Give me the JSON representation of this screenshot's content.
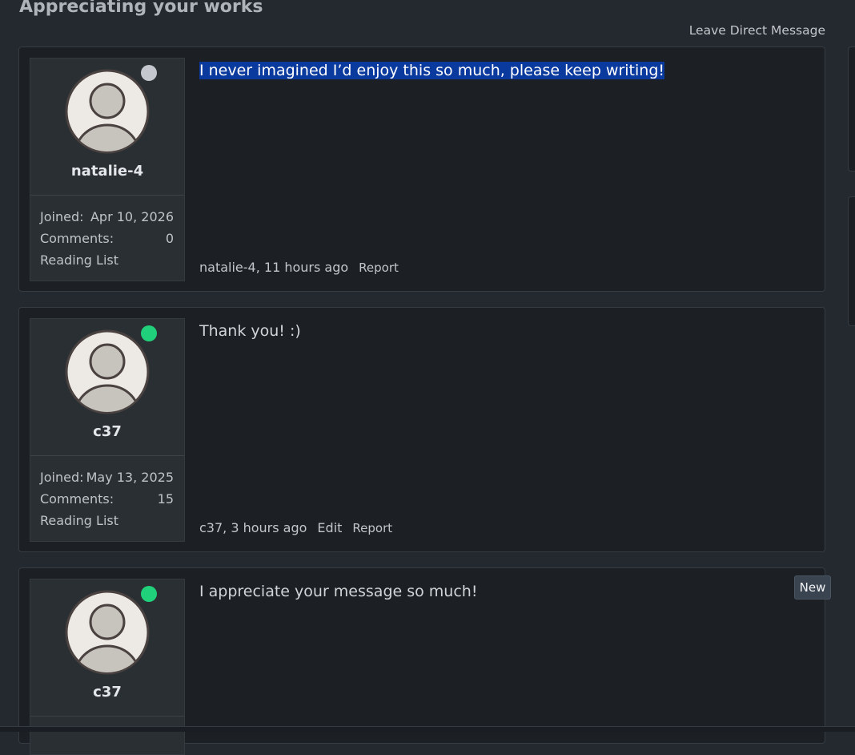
{
  "page": {
    "title": "Appreciating your works",
    "direct_message_link": "Leave Direct Message"
  },
  "posts": [
    {
      "user": {
        "name": "natalie-4",
        "status": "offline",
        "status_color": "#c4c8ce",
        "joined_label": "Joined:",
        "joined": "Apr 10, 2026",
        "comments_label": "Comments:",
        "comments": "0",
        "reading_list": "Reading List"
      },
      "message": "I never imagined I’d enjoy this so much, please keep writing!",
      "message_selected": true,
      "meta": {
        "author_time": "natalie-4, 11 hours ago",
        "report": "Report"
      }
    },
    {
      "user": {
        "name": "c37",
        "status": "online",
        "status_color": "#21d07a",
        "joined_label": "Joined:",
        "joined": "May 13, 2025",
        "comments_label": "Comments:",
        "comments": "15",
        "reading_list": "Reading List"
      },
      "message": "Thank you! :)",
      "message_selected": false,
      "meta": {
        "author_time": "c37, 3 hours ago",
        "edit": "Edit",
        "report": "Report"
      }
    },
    {
      "user": {
        "name": "c37",
        "status": "online",
        "status_color": "#21d07a"
      },
      "message": "I appreciate your message so much!",
      "message_selected": false,
      "badge": "New"
    }
  ],
  "icons": {
    "avatar": "user-avatar-icon",
    "status": "status-dot-icon"
  },
  "colors": {
    "background": "#23292f",
    "card": "#1c2024",
    "selection": "#0a3a9e",
    "online": "#21d07a",
    "offline": "#c4c8ce"
  }
}
